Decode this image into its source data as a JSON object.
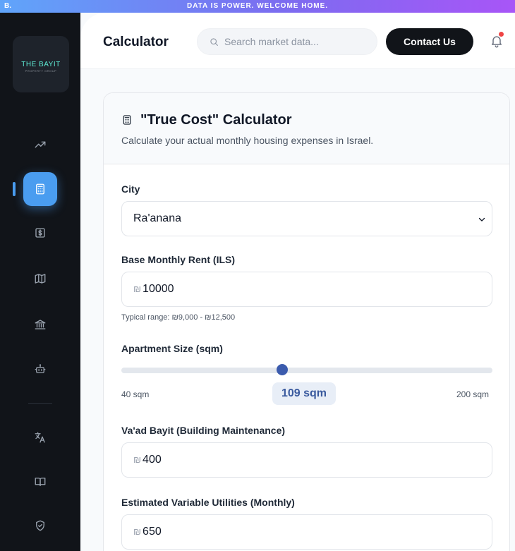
{
  "banner": {
    "brand": "B.",
    "message": "DATA IS POWER. WELCOME HOME."
  },
  "sidebar": {
    "logo": {
      "name": "THE BAYIT",
      "tagline": "PROPERTY GROUP"
    },
    "items": [
      {
        "icon": "trending-up-icon",
        "active": false
      },
      {
        "icon": "calculator-icon",
        "active": true
      },
      {
        "icon": "dollar-sign-icon",
        "active": false
      },
      {
        "icon": "map-icon",
        "active": false
      },
      {
        "icon": "bank-icon",
        "active": false
      },
      {
        "icon": "bot-icon",
        "active": false
      },
      {
        "icon": "translate-icon",
        "active": false
      },
      {
        "icon": "book-icon",
        "active": false
      },
      {
        "icon": "shield-check-icon",
        "active": false
      }
    ],
    "accent_color": "#4a9df0"
  },
  "header": {
    "title": "Calculator",
    "search": {
      "placeholder": "Search market data...",
      "value": ""
    },
    "contact_label": "Contact Us",
    "notification_dot_color": "#ef4444"
  },
  "card": {
    "title": "\"True Cost\" Calculator",
    "subtitle": "Calculate your actual monthly housing expenses in Israel.",
    "city": {
      "label": "City",
      "value": "Ra'anana"
    },
    "rent": {
      "label": "Base Monthly Rent (ILS)",
      "currency": "₪",
      "value": "10000",
      "hint": "Typical range: ₪9,000 - ₪12,500"
    },
    "size": {
      "label": "Apartment Size (sqm)",
      "min_label": "40 sqm",
      "max_label": "200 sqm",
      "value_label": "109 sqm",
      "min": 40,
      "max": 200,
      "value": 109
    },
    "vaad": {
      "label": "Va'ad Bayit (Building Maintenance)",
      "currency": "₪",
      "value": "400"
    },
    "utilities": {
      "label": "Estimated Variable Utilities (Monthly)",
      "currency": "₪",
      "value": "650"
    }
  }
}
